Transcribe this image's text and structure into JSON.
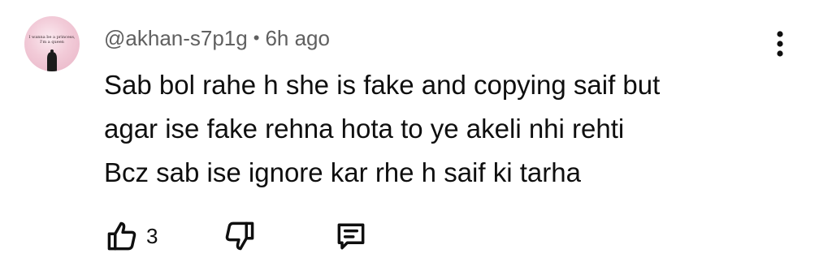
{
  "comment": {
    "avatar": {
      "icon": "profile-picture",
      "tiny_text_line1": "I wanna be a princess,",
      "tiny_text_line2": "I'm a queen"
    },
    "author": "@akhan-s7p1g",
    "separator": "•",
    "timestamp": "6h ago",
    "lines": [
      "Sab bol rahe h she is fake and copying saif but",
      "agar ise fake rehna hota to ye akeli nhi rehti",
      "Bcz sab ise ignore kar rhe h saif ki tarha"
    ],
    "actions": {
      "like_icon": "thumbs-up-icon",
      "like_count": "3",
      "dislike_icon": "thumbs-down-icon",
      "reply_icon": "comment-reply-icon",
      "more_icon": "more-vertical-icon"
    }
  },
  "colors": {
    "text_primary": "#0f0f0f",
    "text_secondary": "#606060",
    "avatar_bg": "#f2cbd8"
  }
}
